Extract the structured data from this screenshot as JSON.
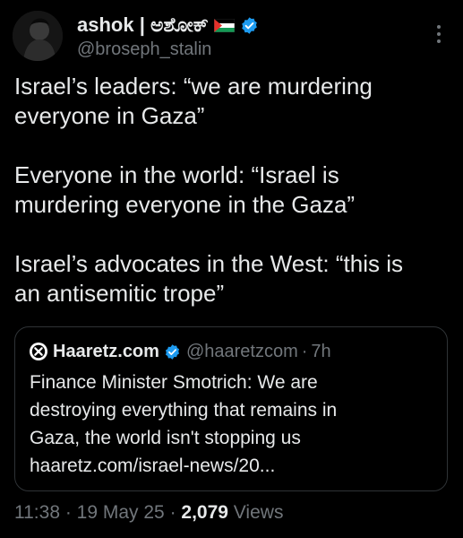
{
  "author": {
    "display_name": "ashok | ಅಶೋಕ್",
    "handle": "@broseph_stalin",
    "flag_icon": "palestine-flag-icon",
    "verified_icon": "verified-badge-icon",
    "avatar_icon": "user-avatar"
  },
  "tweet": {
    "paragraphs": [
      "Israel’s leaders: “we are murdering\neveryone in Gaza”",
      "Everyone in the world: “Israel is\nmurdering everyone in the Gaza”",
      "Israel’s advocates in the West: “this is\nan antisemitic trope”"
    ]
  },
  "quote": {
    "name": "Haaretz.com",
    "handle": "@haaretzcom",
    "separator": "·",
    "time": "7h",
    "text": "Finance Minister Smotrich: We are\ndestroying everything that remains in\nGaza, the world isn't stopping us\nhaaretz.com/israel-news/20..."
  },
  "footer": {
    "time": "11:38",
    "sep1": " · ",
    "date": "19 May 25",
    "sep2": " · ",
    "views_count": "2,079",
    "views_label": " Views"
  },
  "colors": {
    "background": "#000000",
    "text": "#e7e9ea",
    "secondary": "#71767b",
    "verified": "#1d9bf0",
    "border": "#2f3336"
  }
}
